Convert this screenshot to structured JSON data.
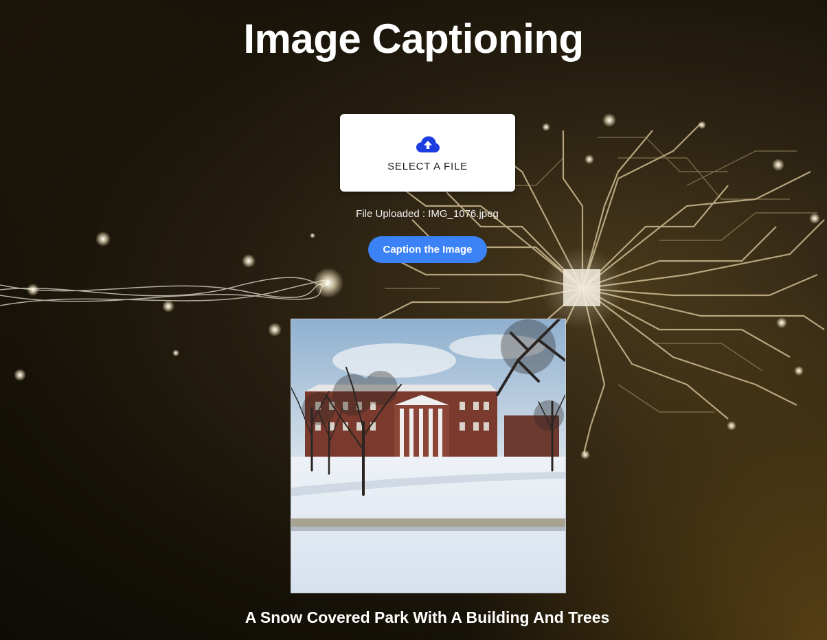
{
  "page": {
    "title": "Image Captioning"
  },
  "upload": {
    "icon": "cloud-upload-icon",
    "label": "SELECT A FILE",
    "status": "File Uploaded : IMG_1076.jpeg"
  },
  "actions": {
    "caption_button": "Caption the Image"
  },
  "result": {
    "caption": "A Snow Covered Park With A Building And Trees"
  },
  "colors": {
    "accent_button": "#3b82f6",
    "upload_icon": "#1d3de0",
    "background_gold": "#b8a47a"
  }
}
